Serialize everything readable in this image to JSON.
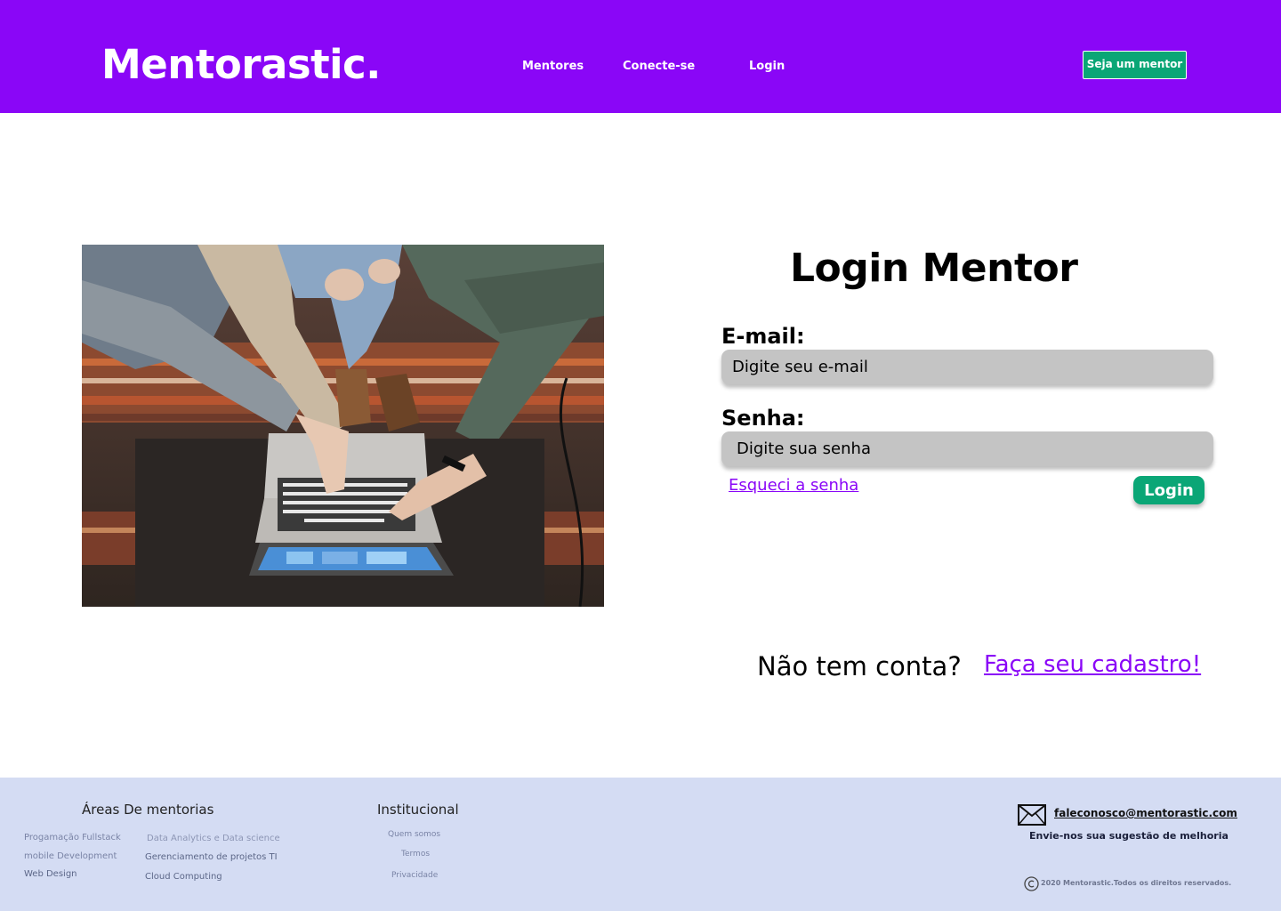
{
  "header": {
    "logo": "Mentorastic.",
    "nav": {
      "mentores": "Mentores",
      "conecte": "Conecte-se",
      "login": "Login"
    },
    "cta": "Seja um mentor",
    "bg_color": "#8a06f7"
  },
  "hero_image": {
    "icon": "team-laptop-photo"
  },
  "login": {
    "title": "Login Mentor",
    "email_label": "E-mail:",
    "email_placeholder": "Digite seu e-mail",
    "password_label": "Senha:",
    "password_placeholder": "Digite sua senha",
    "forgot": "Esqueci a senha",
    "submit": "Login",
    "no_account": "Não tem conta?",
    "signup": "Faça seu cadastro!",
    "accent_color": "#0aa676",
    "link_color": "#8a06f7"
  },
  "footer": {
    "areas_heading": "Áreas De mentorias",
    "areas": [
      "Progamação Fullstack",
      "mobile Development",
      "Web Design",
      "Data Analytics e Data science",
      "Gerenciamento de projetos TI",
      "Cloud Computing"
    ],
    "institutional_heading": "Institucional",
    "institutional": [
      "Quem somos",
      "Termos",
      "Privacidade"
    ],
    "email": "faleconosco@mentorastic.com",
    "suggestion": "Envie-nos sua sugestão de melhoria",
    "copyright": "2020 Mentorastic.Todos os direitos reservados.",
    "bg_color": "#d4dcf3"
  }
}
